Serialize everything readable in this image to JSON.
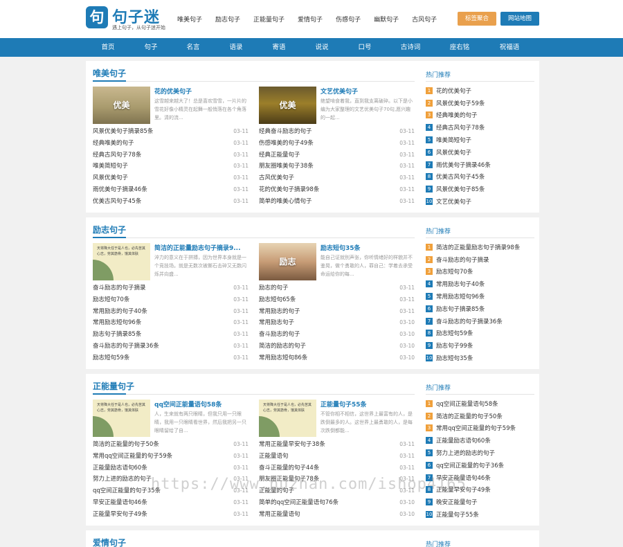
{
  "logo": {
    "name": "句子迷",
    "slogan": "遇上句子，从句子迷开始",
    "icon": "句"
  },
  "top_nav": [
    "唯美句子",
    "励志句子",
    "正能量句子",
    "爱情句子",
    "伤感句子",
    "幽默句子",
    "古风句子"
  ],
  "buttons": {
    "tags": "标签聚合",
    "sitemap": "网站地图"
  },
  "main_nav": [
    "首页",
    "句子",
    "名言",
    "语录",
    "寄语",
    "说说",
    "口号",
    "古诗词",
    "座右铭",
    "祝福语"
  ],
  "colors": {
    "brand": "#1e7bb6",
    "accent": "#e9a04d"
  },
  "sections": [
    {
      "title": "唯美句子",
      "featured": [
        {
          "img_label": "优美",
          "title": "花的优美句子",
          "desc": "这雪越来越大了！总是喜欢雪雪，一片片的雪花好像小精灵在起舞一般悄落在各个角落里。清的流..."
        },
        {
          "img_label": "优美",
          "title": "文艺优美句子",
          "desc": "绝望啃食着我，直到我支离破碎。以下是小编为大家整理的文艺优美句子70句,愿兴趣的一起..."
        }
      ],
      "list_left": [
        {
          "title": "风景优美句子摘录85条",
          "date": "03-11"
        },
        {
          "title": "经典唯美的句子",
          "date": "03-11"
        },
        {
          "title": "经典古风句子78条",
          "date": "03-11"
        },
        {
          "title": "唯美简短句子",
          "date": "03-11"
        },
        {
          "title": "风景优美句子",
          "date": "03-11"
        },
        {
          "title": "雨优美句子摘录46条",
          "date": "03-11"
        },
        {
          "title": "优美古风句子45条",
          "date": "03-11"
        }
      ],
      "list_right": [
        {
          "title": "经典奋斗励志的句子",
          "date": "03-11"
        },
        {
          "title": "伤感唯美的句子49条",
          "date": "03-11"
        },
        {
          "title": "经典正能量句子",
          "date": "03-11"
        },
        {
          "title": "朋友圈唯美句子38条",
          "date": "03-11"
        },
        {
          "title": "古风优美句子",
          "date": "03-11"
        },
        {
          "title": "花的优美句子摘录98条",
          "date": "03-11"
        },
        {
          "title": "简单的唯美心情句子",
          "date": "03-11"
        }
      ],
      "side_title": "热门推荐",
      "side": [
        "花的优美句子",
        "风景优美句子59条",
        "经典唯美的句子",
        "经典古风句子78条",
        "唯美简短句子",
        "风景优美句子",
        "雨优美句子摘录46条",
        "优美古风句子45条",
        "风景优美句子85条",
        "文艺优美句子"
      ]
    },
    {
      "title": "励志句子",
      "featured": [
        {
          "img_label": "天将降大任于是人也，必先苦其心志，劳其筋骨，饿其体肤",
          "title": "简洁的正能量励志句子摘录9...",
          "desc": "淬力的意义在于拼搏，因为世界本身就是一个竞技场。就是无数次被撕石击碎又无数闪烁并向盛..."
        },
        {
          "img_label": "励志",
          "title": "励志短句35条",
          "desc": "能自己证就别声张，你听情绪好的样貌并不鉴晃，做个勇敢的人，罪自己：学着去承受命运给你的每..."
        }
      ],
      "list_left": [
        {
          "title": "奋斗励志的句子摘录",
          "date": "03-11"
        },
        {
          "title": "励志短句70条",
          "date": "03-11"
        },
        {
          "title": "常用励志的句子40条",
          "date": "03-11"
        },
        {
          "title": "常用励志短句96条",
          "date": "03-11"
        },
        {
          "title": "励志句子摘录85条",
          "date": "03-11"
        },
        {
          "title": "奋斗励志的句子摘录36条",
          "date": "03-11"
        },
        {
          "title": "励志短句59条",
          "date": "03-11"
        }
      ],
      "list_right": [
        {
          "title": "励志的句子",
          "date": "03-11"
        },
        {
          "title": "励志短句65条",
          "date": "03-11"
        },
        {
          "title": "常用励志的句子",
          "date": "03-11"
        },
        {
          "title": "常用励志句子",
          "date": "03-10"
        },
        {
          "title": "奋斗励志的句子",
          "date": "03-10"
        },
        {
          "title": "简洁的励志的句子",
          "date": "03-10"
        },
        {
          "title": "常用励志短句86条",
          "date": "03-10"
        }
      ],
      "side_title": "热门推荐",
      "side": [
        "简洁的正能量励志句子摘录98条",
        "奋斗励志的句子摘录",
        "励志短句70条",
        "常用励志句子40条",
        "常用励志短句96条",
        "励志句子摘录85条",
        "奋斗励志的句子摘录36条",
        "励志短句59条",
        "励志句子99条",
        "励志短句35条"
      ]
    },
    {
      "title": "正能量句子",
      "featured": [
        {
          "img_label": "天将降大任于是人也，必先苦其心志，劳其筋骨，饿其体肤",
          "title": "qq空间正能量语句58条",
          "desc": "人，生来就有两只眼睛，但我只用一只眼睛，我用一只眼睛看世界，然后我把另一只眼睛留给了自..."
        },
        {
          "img_label": "天将降大任于是人也，必先苦其心志，劳其筋骨，饿其体肤",
          "title": "正能量句子55条",
          "desc": "不管你相不相信，这世界上最富有的人，是跌倒最多的人。这世界上最勇敢的人，是每次跌倒都能..."
        }
      ],
      "list_left": [
        {
          "title": "简洁的正能量的句子50条",
          "date": "03-11"
        },
        {
          "title": "常用qq空间正能量的句子59条",
          "date": "03-11"
        },
        {
          "title": "正能量励志语句60条",
          "date": "03-11"
        },
        {
          "title": "努力上进的励志的句子",
          "date": "03-11"
        },
        {
          "title": "qq空间正能量的句子35条",
          "date": "03-11"
        },
        {
          "title": "早安正能量语句46条",
          "date": "03-11"
        },
        {
          "title": "正能量早安句子49条",
          "date": "03-11"
        }
      ],
      "list_right": [
        {
          "title": "常用正能量早安句子38条",
          "date": "03-11"
        },
        {
          "title": "正能量语句",
          "date": "03-11"
        },
        {
          "title": "奋斗正能量的句子44条",
          "date": "03-11"
        },
        {
          "title": "朋友圈正能量句子78条",
          "date": "03-11"
        },
        {
          "title": "正能量的句子",
          "date": "03-11"
        },
        {
          "title": "简单的qq空间正能量语句76条",
          "date": "03-10"
        },
        {
          "title": "常用正能量语句",
          "date": "03-10"
        }
      ],
      "side_title": "热门推荐",
      "side": [
        "qq空间正能量语句58条",
        "简洁的正能量的句子50条",
        "常用qq空间正能量的句子59条",
        "正能量励志语句60条",
        "努力上进的励志的句子",
        "qq空间正能量的句子36条",
        "早安正能量语句46条",
        "正能量早安句子49条",
        "晚安正能量句子",
        "正能量句子55条"
      ]
    },
    {
      "title": "爱情句子",
      "side_title": "热门推荐"
    }
  ],
  "watermark": "https://www.huzhan.com/ishop4165"
}
